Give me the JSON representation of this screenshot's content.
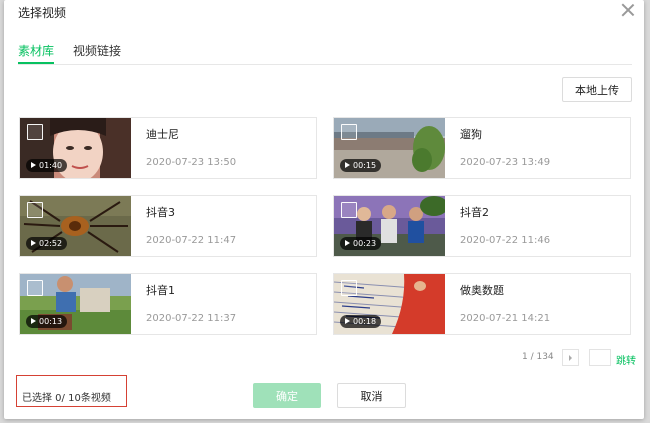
{
  "dialog": {
    "title": "选择视频",
    "close_icon": "close-icon"
  },
  "tabs": [
    {
      "label": "素材库",
      "active": true
    },
    {
      "label": "视频链接",
      "active": false
    }
  ],
  "toolbar": {
    "upload_label": "本地上传"
  },
  "videos": [
    {
      "name": "迪士尼",
      "date": "2020-07-23 13:50",
      "duration": "01:40"
    },
    {
      "name": "遛狗",
      "date": "2020-07-23 13:49",
      "duration": "00:15"
    },
    {
      "name": "抖音3",
      "date": "2020-07-22 11:47",
      "duration": "02:52"
    },
    {
      "name": "抖音2",
      "date": "2020-07-22 11:46",
      "duration": "00:23"
    },
    {
      "name": "抖音1",
      "date": "2020-07-22 11:37",
      "duration": "00:13"
    },
    {
      "name": "做奥数题",
      "date": "2020-07-21 14:21",
      "duration": "00:18"
    }
  ],
  "pagination": {
    "page_info": "1 / 134",
    "jump_label": "跳转"
  },
  "footer": {
    "selected_text": "已选择 0/ 10条视频",
    "confirm_label": "确定",
    "cancel_label": "取消"
  },
  "colors": {
    "accent": "#07c160",
    "confirm_disabled": "#9fe1b9",
    "highlight_box": "#d54134"
  }
}
